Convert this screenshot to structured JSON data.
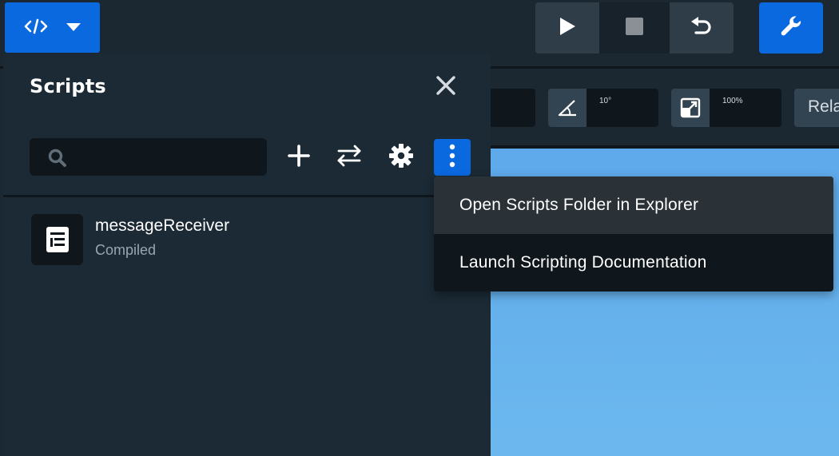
{
  "topbar": {
    "scripts_toggle_icon": "code-icon",
    "dropdown_icon": "caret-down-icon",
    "play_icon": "play-icon",
    "stop_icon": "stop-icon",
    "undo_icon": "undo-icon",
    "tools_icon": "wrench-icon",
    "accent_color": "#0b69e0"
  },
  "toolbar": {
    "rotation_snap_value": "10°",
    "scale_snap_value": "100%",
    "relative_label": "Rela"
  },
  "panel": {
    "title": "Scripts",
    "search": {
      "placeholder": "",
      "value": ""
    },
    "scripts": [
      {
        "name": "messageReceiver",
        "status": "Compiled"
      }
    ]
  },
  "menu": {
    "items": [
      {
        "label": "Open Scripts Folder in Explorer"
      },
      {
        "label": "Launch Scripting Documentation"
      }
    ]
  }
}
